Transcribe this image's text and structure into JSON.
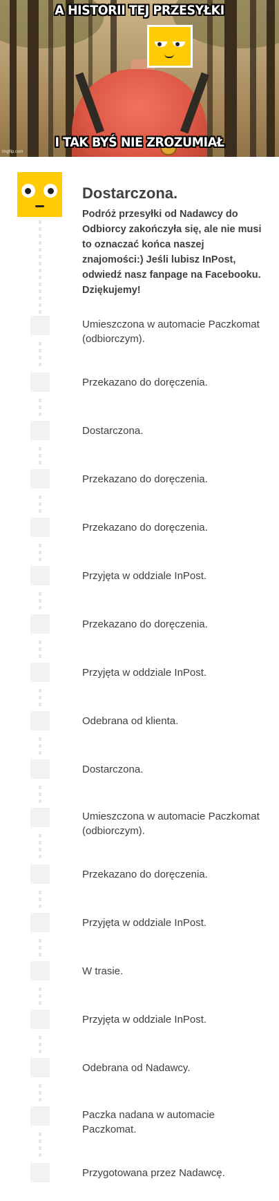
{
  "meme": {
    "top_text": "A HISTORII TEJ PRZESYŁKI",
    "bottom_text": "I TAK BYŚ NIE ZROZUMIAŁ",
    "watermark": "imgflip.com",
    "colors": {
      "sweater": "#dd5945",
      "forest": "#b59c6f"
    }
  },
  "tracking": {
    "accent_color": "#ffcb05",
    "latest": {
      "icon": "inpost-character-icon",
      "status": "Dostarczona.",
      "description": "Podróż przesyłki od Nadawcy do Odbiorcy zakończyła się, ale nie musi to oznaczać końca naszej znajomości:) Jeśli lubisz InPost, odwiedź nasz fanpage na Facebooku. Dziękujemy!"
    },
    "events": [
      {
        "status": "Umieszczona w automacie Paczkomat (odbiorczym)."
      },
      {
        "status": "Przekazano do doręczenia."
      },
      {
        "status": "Dostarczona."
      },
      {
        "status": "Przekazano do doręczenia."
      },
      {
        "status": "Przekazano do doręczenia."
      },
      {
        "status": "Przyjęta w oddziale InPost."
      },
      {
        "status": "Przekazano do doręczenia."
      },
      {
        "status": "Przyjęta w oddziale InPost."
      },
      {
        "status": "Odebrana od klienta."
      },
      {
        "status": "Dostarczona."
      },
      {
        "status": "Umieszczona w automacie Paczkomat (odbiorczym)."
      },
      {
        "status": "Przekazano do doręczenia."
      },
      {
        "status": "Przyjęta w oddziale InPost."
      },
      {
        "status": "W trasie."
      },
      {
        "status": "Przyjęta w oddziale InPost."
      },
      {
        "status": "Odebrana od Nadawcy."
      },
      {
        "status": "Paczka nadana w automacie Paczkomat."
      },
      {
        "status": "Przygotowana przez Nadawcę."
      }
    ]
  }
}
